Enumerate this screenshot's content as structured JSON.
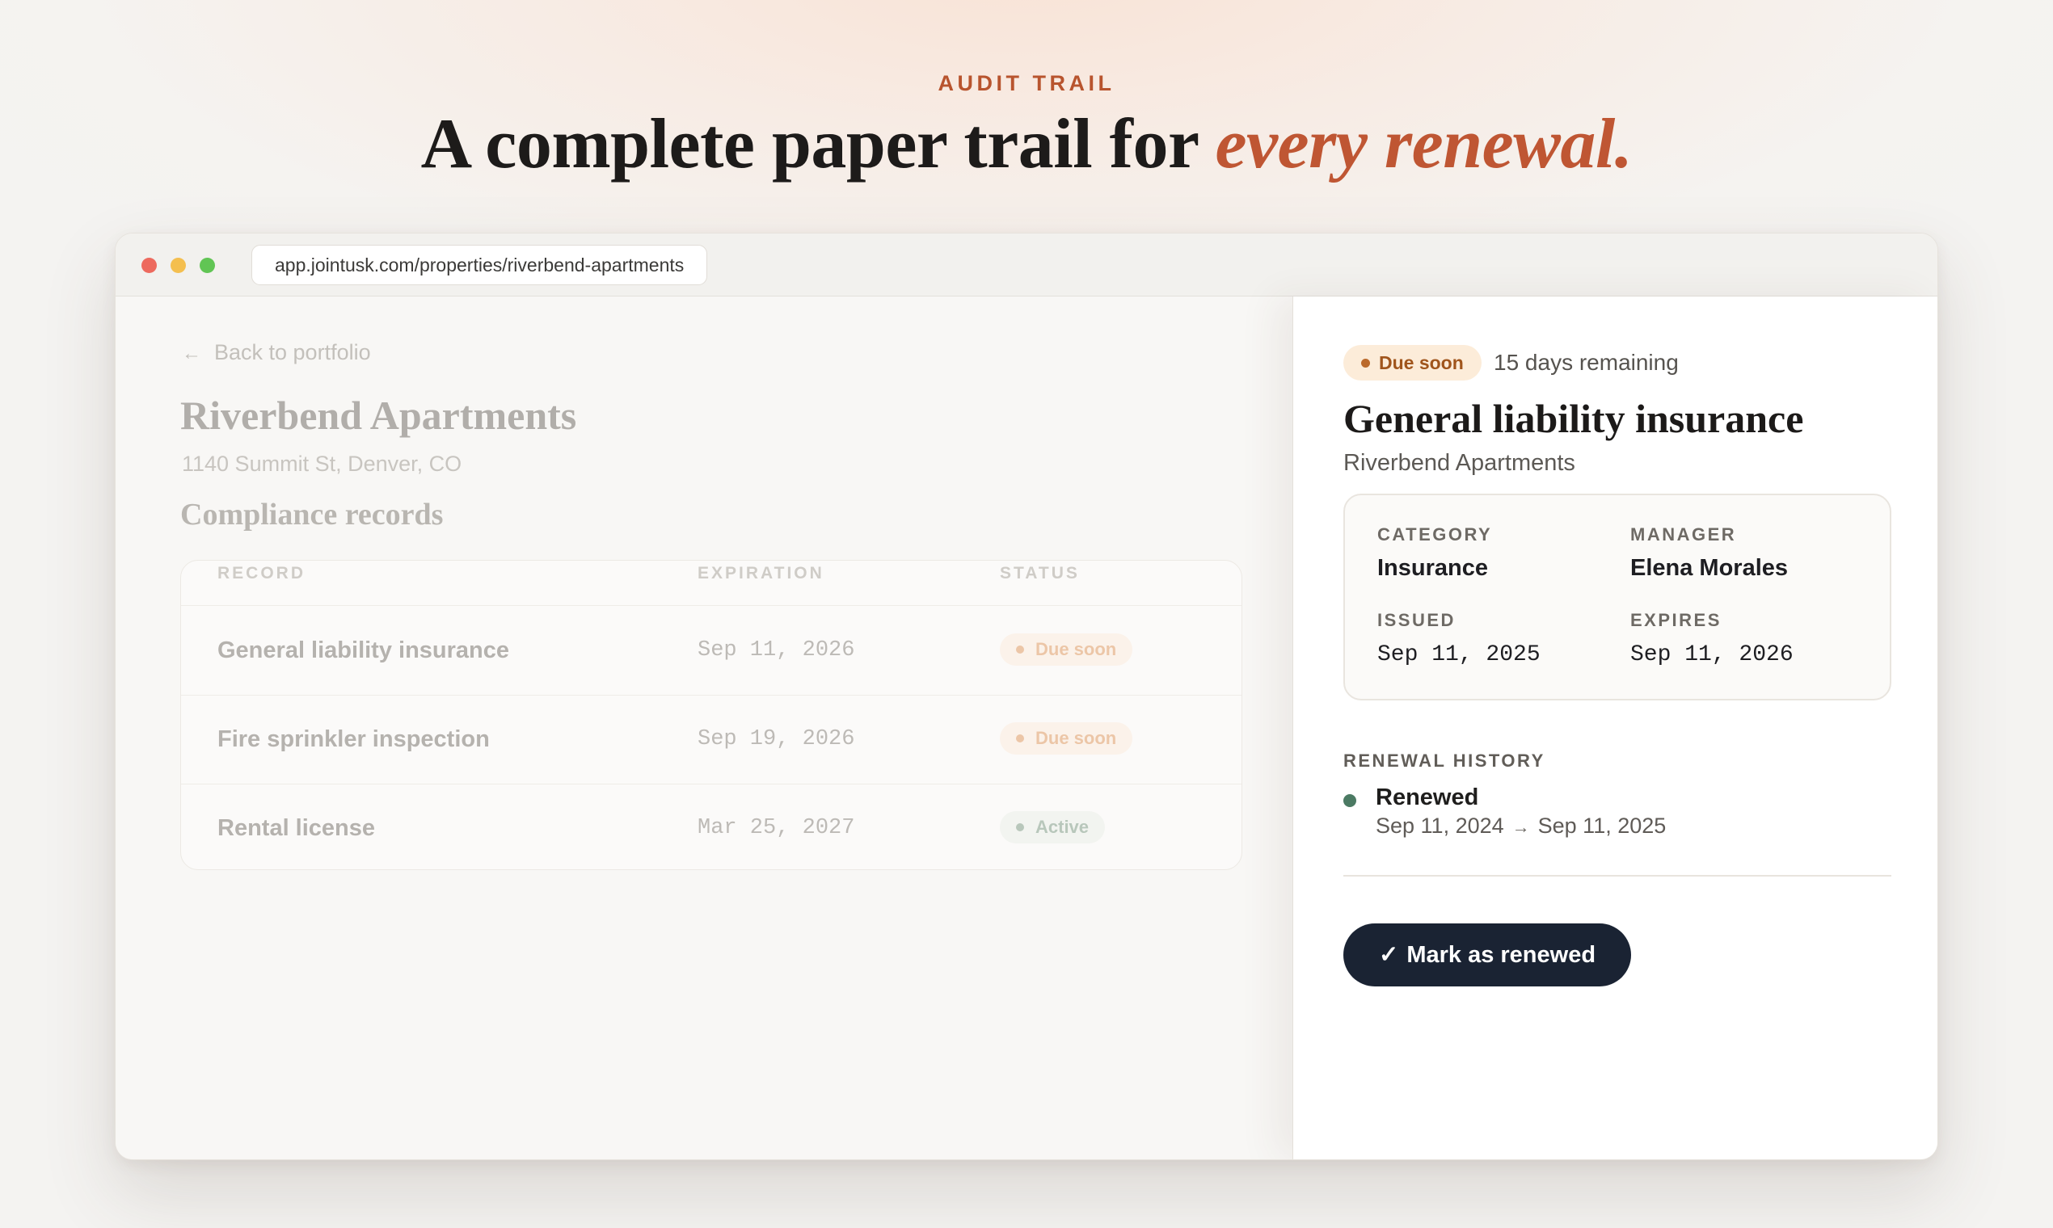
{
  "hero": {
    "eyebrow": "AUDIT TRAIL",
    "headline_plain": "A complete paper trail for ",
    "headline_accent": "every renewal."
  },
  "browser": {
    "url": "app.jointusk.com/properties/riverbend-apartments"
  },
  "property": {
    "back_label": "Back to portfolio",
    "back_icon": "arrow-left-icon",
    "name": "Riverbend Apartments",
    "address": "1140 Summit St, Denver, CO",
    "section_title": "Compliance records",
    "columns": [
      "RECORD",
      "EXPIRATION",
      "STATUS"
    ],
    "records": [
      {
        "name": "General liability insurance",
        "expiration": "Sep 11, 2026",
        "status": "Due soon",
        "status_kind": "due"
      },
      {
        "name": "Fire sprinkler inspection",
        "expiration": "Sep 19, 2026",
        "status": "Due soon",
        "status_kind": "due"
      },
      {
        "name": "Rental license",
        "expiration": "Mar 25, 2027",
        "status": "Active",
        "status_kind": "active"
      }
    ]
  },
  "detail": {
    "status": "Due soon",
    "days_remaining": "15 days remaining",
    "title": "General liability insurance",
    "subtitle": "Riverbend Apartments",
    "fields": {
      "category_label": "CATEGORY",
      "category_value": "Insurance",
      "manager_label": "MANAGER",
      "manager_value": "Elena Morales",
      "issued_label": "ISSUED",
      "issued_value": "Sep 11, 2025",
      "expires_label": "EXPIRES",
      "expires_value": "Sep 11, 2026"
    },
    "history_heading": "RENEWAL HISTORY",
    "history": [
      {
        "title": "Renewed",
        "from": "Sep 11, 2024",
        "arrow": "→",
        "to": "Sep 11, 2025"
      }
    ],
    "action": {
      "check": "✓",
      "label": "Mark as renewed"
    }
  },
  "colors": {
    "accent": "#bf5633",
    "due_badge_bg": "#fcecd9",
    "due_badge_text": "#a0551c",
    "history_dot": "#4b7a63",
    "primary_button": "#1a2333"
  }
}
